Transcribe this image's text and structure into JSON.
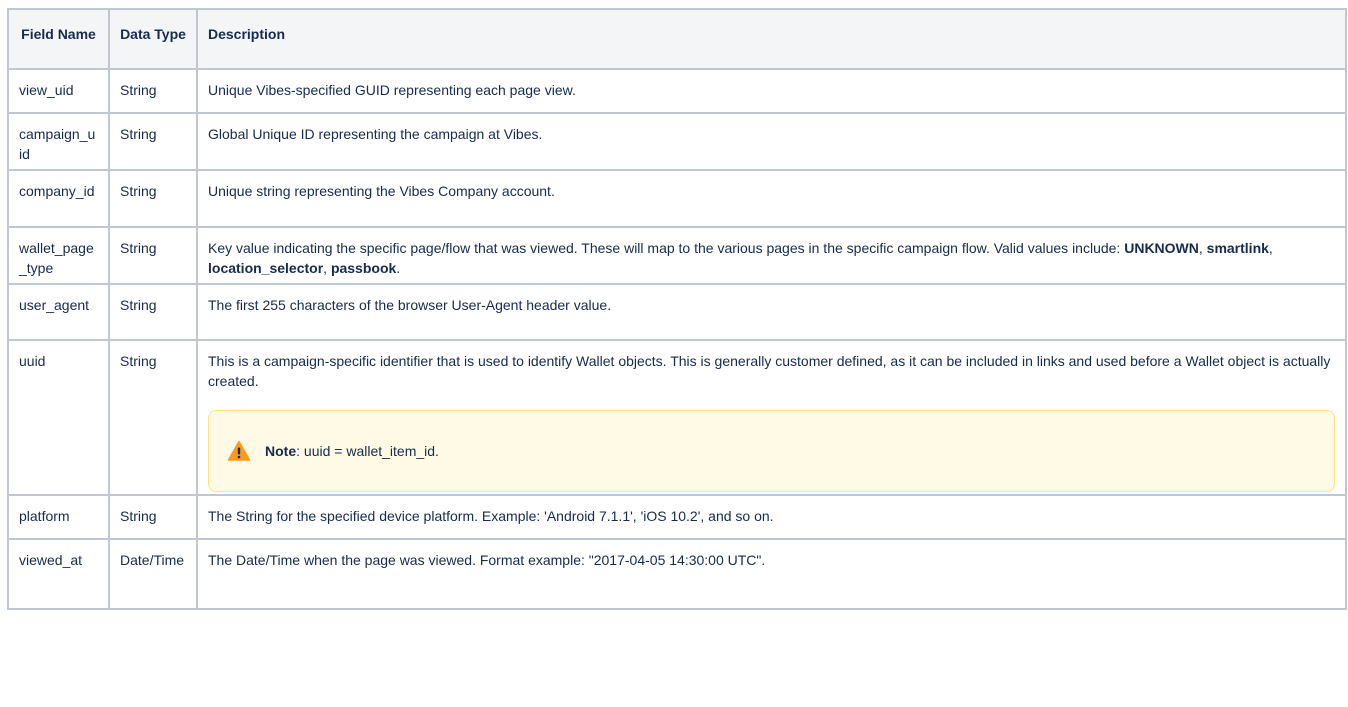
{
  "headers": {
    "field_name": "Field Name",
    "data_type": "Data Type",
    "description": "Description"
  },
  "rows": [
    {
      "field": "view_uid",
      "type": "String",
      "description": "Unique Vibes-specified GUID representing each page view."
    },
    {
      "field": "campaign_uid",
      "type": "String",
      "description": "Global Unique ID representing the campaign at Vibes."
    },
    {
      "field": "company_id",
      "type": "String",
      "description": "Unique string representing the Vibes Company account."
    },
    {
      "field": "wallet_page_type",
      "type": "String",
      "description_intro": "Key value indicating the specific page/flow that was viewed. These will map to the various pages in the specific campaign flow. Valid values include: ",
      "values": [
        "UNKNOWN",
        "smartlink",
        "location_selector",
        "passbook"
      ],
      "separator": ", ",
      "end": "."
    },
    {
      "field": "user_agent",
      "type": "String",
      "description": "The first 255 characters of the browser User-Agent header value."
    },
    {
      "field": "uuid",
      "type": "String",
      "description": "This is a campaign-specific identifier that is used to identify Wallet objects. This is generally customer defined, as it can be included in links and used before a Wallet object is actually created.",
      "note_label": "Note",
      "note_text": ": uuid = wallet_item_id."
    },
    {
      "field": "platform",
      "type": "String",
      "description": "The String for the specified device platform. Example: 'Android 7.1.1', 'iOS 10.2', and so on."
    },
    {
      "field": "viewed_at",
      "type": "Date/Time",
      "description": "The Date/Time when the page was viewed. Format example: \"2017-04-05 14:30:00 UTC\"."
    }
  ],
  "colors": {
    "header_bg": "#f4f5f7",
    "border": "#c1c7d0",
    "note_bg": "#fffae6",
    "note_border": "#ffe380",
    "warning_icon": "#ff991f"
  },
  "icons": {
    "note": "warning-icon"
  }
}
